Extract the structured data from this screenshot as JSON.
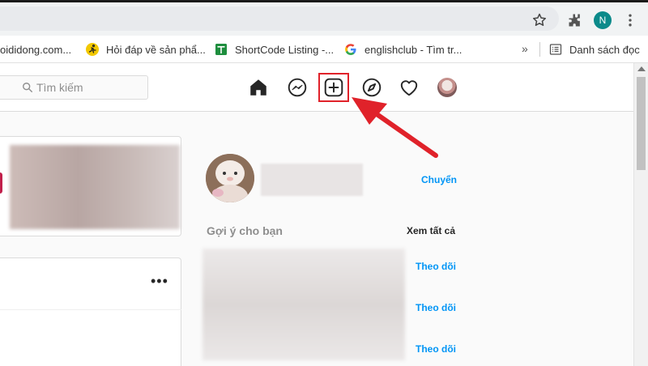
{
  "browser": {
    "profile_initial": "N",
    "bookmarks": [
      {
        "label": "oididong.com..."
      },
      {
        "label": "Hỏi đáp về sản phẩ..."
      },
      {
        "label": "ShortCode Listing -..."
      },
      {
        "label": "englishclub - Tìm tr..."
      }
    ],
    "more_label": "»",
    "reading_list_label": "Danh sách đọc"
  },
  "ig": {
    "search_placeholder": "Tìm kiếm",
    "switch_label": "Chuyển",
    "suggestions_title": "Gợi ý cho bạn",
    "see_all_label": "Xem tất cả",
    "follow_labels": [
      "Theo dõi",
      "Theo dõi",
      "Theo dõi"
    ],
    "post_menu": "•••"
  },
  "colors": {
    "accent_blue": "#0095f6",
    "highlight_red": "#e0222a",
    "profile_teal": "#0b8a8a"
  },
  "icons": [
    "star-icon",
    "extensions-icon",
    "menu-icon",
    "home-icon",
    "messenger-icon",
    "create-post-icon",
    "explore-icon",
    "heart-icon",
    "search-icon"
  ]
}
